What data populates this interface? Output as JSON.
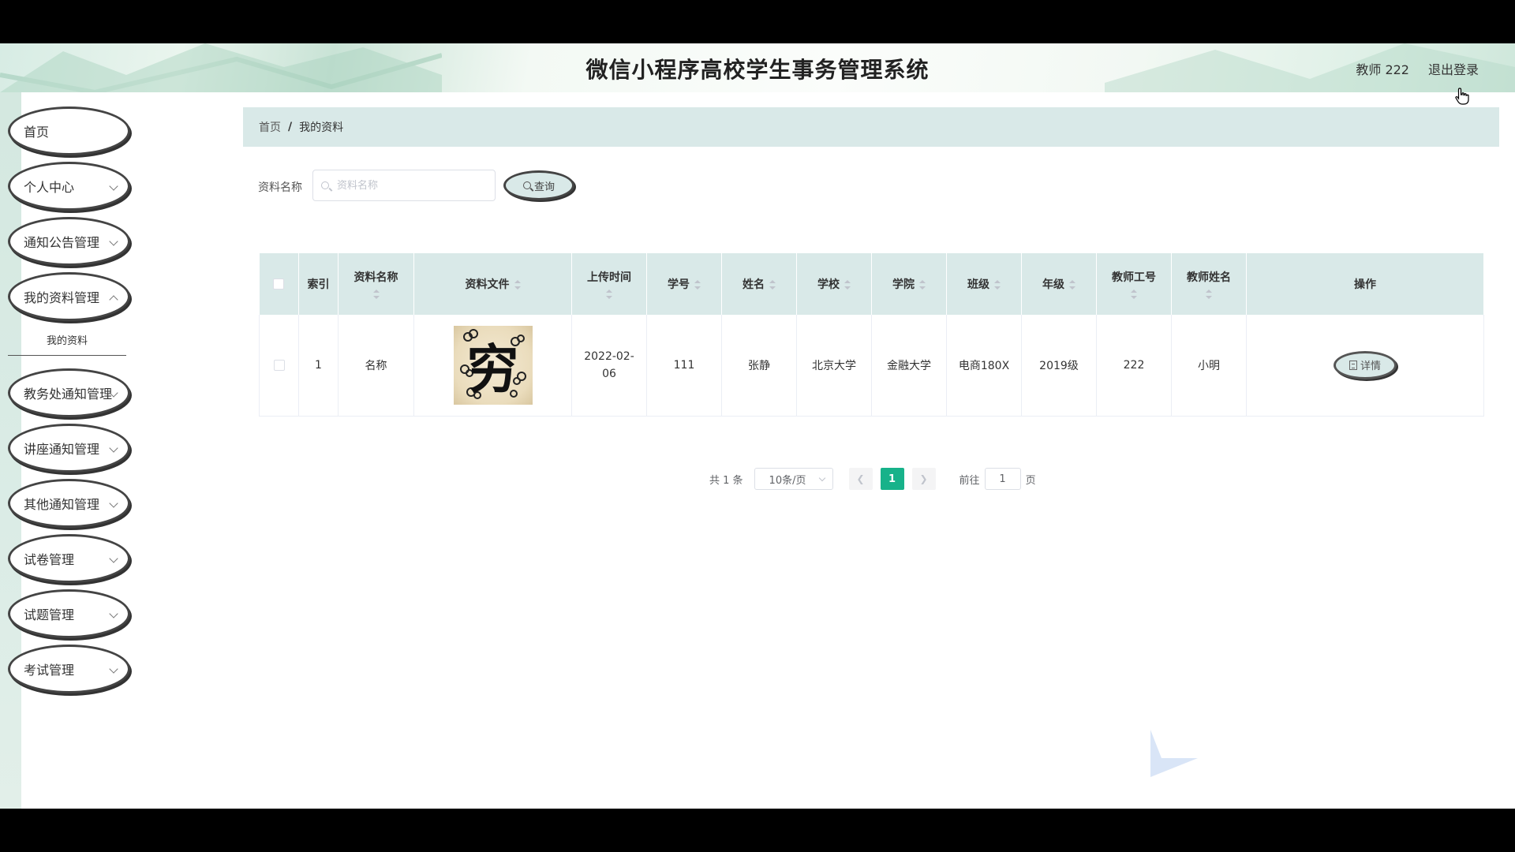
{
  "app": {
    "title": "微信小程序高校学生事务管理系统"
  },
  "header": {
    "user_label": "教师 222",
    "logout_label": "退出登录"
  },
  "sidebar": {
    "items": [
      {
        "label": "首页",
        "has_children": false
      },
      {
        "label": "个人中心",
        "has_children": true
      },
      {
        "label": "通知公告管理",
        "has_children": true
      },
      {
        "label": "我的资料管理",
        "has_children": true,
        "submenu": "我的资料"
      },
      {
        "label": "教务处通知管理",
        "has_children": true
      },
      {
        "label": "讲座通知管理",
        "has_children": true
      },
      {
        "label": "其他通知管理",
        "has_children": true
      },
      {
        "label": "试卷管理",
        "has_children": true
      },
      {
        "label": "试题管理",
        "has_children": true
      },
      {
        "label": "考试管理",
        "has_children": true
      }
    ]
  },
  "breadcrumb": {
    "home": "首页",
    "separator": "/",
    "current": "我的资料"
  },
  "search": {
    "label": "资料名称",
    "placeholder": "资料名称",
    "value": "",
    "button_label": "查询"
  },
  "table": {
    "columns": [
      "索引",
      "资料名称",
      "资料文件",
      "上传时间",
      "学号",
      "姓名",
      "学校",
      "学院",
      "班级",
      "年级",
      "教师工号",
      "教师姓名",
      "操作"
    ],
    "rows": [
      {
        "index": "1",
        "name": "名称",
        "file_image": "qiong-character-image",
        "upload_time": "2022-02-06",
        "student_no": "111",
        "student_name": "张静",
        "school": "北京大学",
        "college": "金融大学",
        "class": "电商180X",
        "grade": "2019级",
        "teacher_no": "222",
        "teacher_name": "小明",
        "action_label": "详情"
      }
    ],
    "image_glyph": "穷"
  },
  "pagination": {
    "total_label": "共 1 条",
    "page_size": "10条/页",
    "current_page": "1",
    "goto_label": "前往",
    "goto_value": "1",
    "page_suffix": "页"
  },
  "colors": {
    "accent": "#17b28a",
    "header_bg": "#d9e9e8"
  }
}
